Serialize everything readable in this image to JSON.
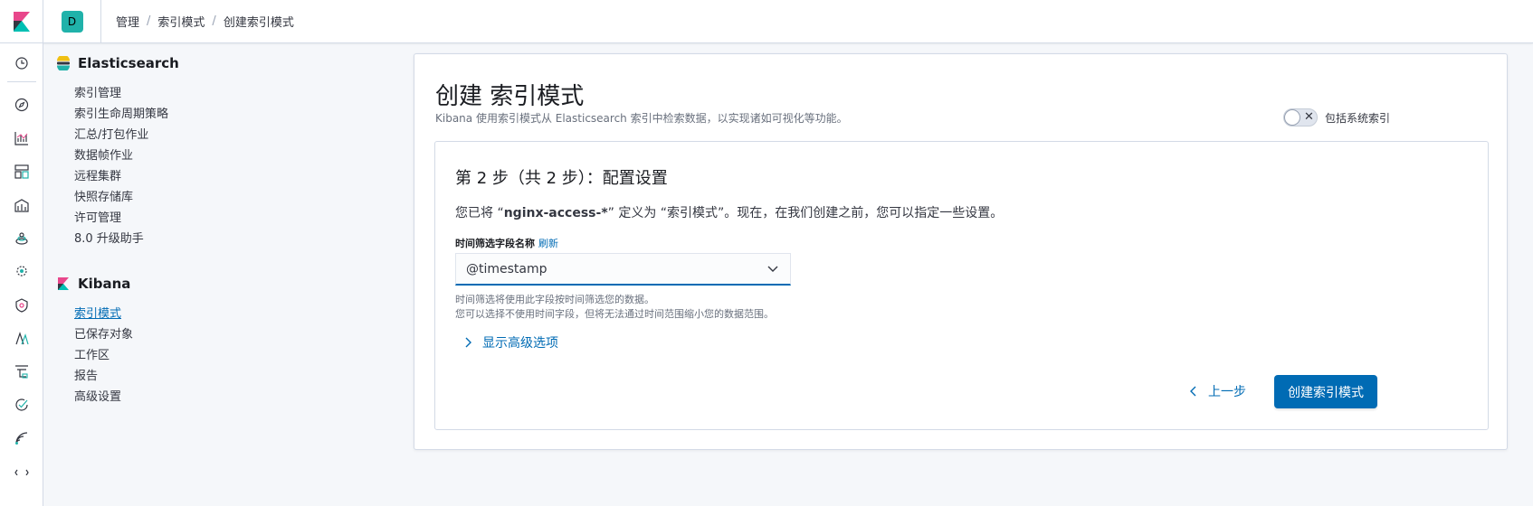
{
  "header": {
    "space_initial": "D",
    "breadcrumbs": [
      "管理",
      "索引模式",
      "创建索引模式"
    ]
  },
  "rail": {
    "icons": [
      "clock-icon",
      "discover-icon",
      "visualize-icon",
      "dashboard-icon",
      "canvas-icon",
      "maps-icon",
      "ml-icon",
      "siem-icon",
      "apm-icon",
      "logs-icon",
      "uptime-icon",
      "dev-tools-icon",
      "stack-monitoring-icon"
    ]
  },
  "sidenav": {
    "elasticsearch": {
      "title": "Elasticsearch",
      "items": [
        "索引管理",
        "索引生命周期策略",
        "汇总/打包作业",
        "数据帧作业",
        "远程集群",
        "快照存储库",
        "许可管理",
        "8.0 升级助手"
      ]
    },
    "kibana": {
      "title": "Kibana",
      "items": [
        "索引模式",
        "已保存对象",
        "工作区",
        "报告",
        "高级设置"
      ],
      "active_index": 0
    }
  },
  "main": {
    "title": "创建 索引模式",
    "description": "Kibana 使用索引模式从 Elasticsearch 索引中检索数据，以实现诸如可视化等功能。",
    "toggle_label": "包括系统索引",
    "toggle_on": false,
    "step": {
      "title": "第 2 步（共 2 步）：配置设置",
      "desc_prefix": "您已将 “",
      "desc_pattern": "nginx-access-*",
      "desc_suffix": "” 定义为 “索引模式”。现在，在我们创建之前，您可以指定一些设置。",
      "field_label": "时间筛选字段名称",
      "refresh_label": "刷新",
      "select_value": "@timestamp",
      "help_line_1": "时间筛选将使用此字段按时间筛选您的数据。",
      "help_line_2": "您可以选择不使用时间字段，但将无法通过时间范围缩小您的数据范围。",
      "advanced_label": "显示高级选项",
      "back_label": "上一步",
      "create_label": "创建索引模式"
    }
  },
  "colors": {
    "primary": "#006bb4",
    "space_avatar": "#20b2aa",
    "elastic_yellow": "#f0c013",
    "elastic_teal": "#20b2aa",
    "kibana_pink": "#e8478b"
  }
}
